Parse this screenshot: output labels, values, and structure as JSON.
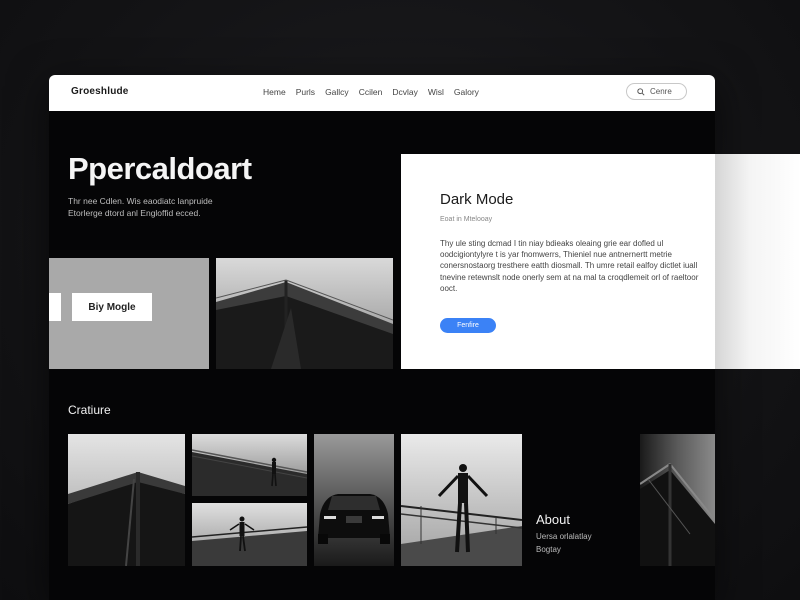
{
  "app": {
    "brand": "Groeshlude",
    "nav": [
      "Heme",
      "Purls",
      "Gallcy",
      "Ccilen",
      "Dcvlay",
      "Wisl",
      "Galory"
    ],
    "search_label": "Cenre"
  },
  "hero": {
    "title": "Ppercaldoart",
    "subtitle_lines": [
      "Thr nee Cdlen. Wis eaodiatc lanpruide",
      "Etorlerge dtord anl Engloffid ecced."
    ]
  },
  "tile_button_label": "Biy Mogle",
  "card": {
    "title": "Dark Mode",
    "meta": "Eoat in Mtelooay",
    "body": "Thy ule sting dcmad I tin niay bdieaks oleaing grie ear dofled ul oodcigiontylyre t is yar fnomwerrs, Thieniel nue antnernertt metrie conersnostaorg tresthere eatth diosmall. Th umre retail ealfoy dictlet iuall tnevine retewnslt node onerly sem at na mal ta croqdlemeit orl of raeltoor ooct.",
    "button_label": "Fenfire"
  },
  "section": {
    "title": "Cratiure"
  },
  "about": {
    "title": "About",
    "lines": [
      "Uersa orlalatlay",
      "Bogtay"
    ]
  },
  "colors": {
    "accent": "#3b82f6",
    "background": "#050506",
    "tile_gray": "#a9a9a9"
  }
}
